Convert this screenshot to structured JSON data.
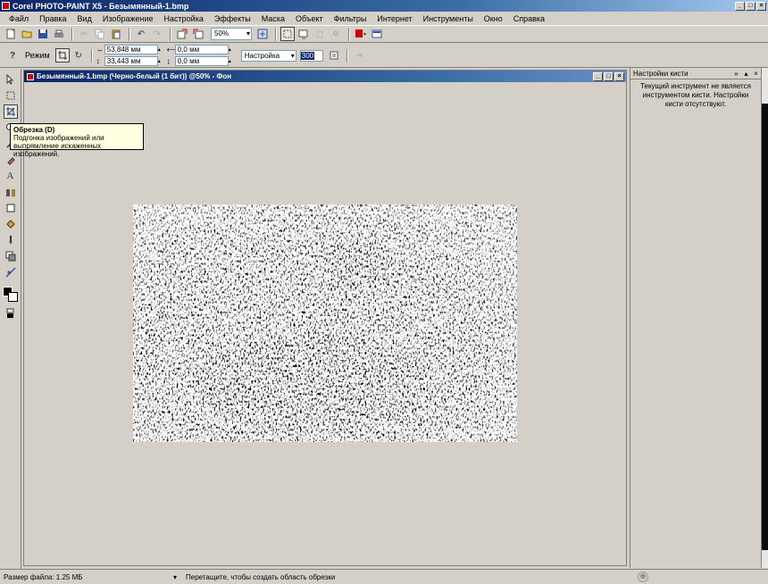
{
  "app": {
    "title": "Corel PHOTO-PAINT X5 - Безымянный-1.bmp",
    "window_controls": [
      "_",
      "□",
      "×"
    ]
  },
  "menu": [
    "Файл",
    "Правка",
    "Вид",
    "Изображение",
    "Настройка",
    "Эффекты",
    "Маска",
    "Объект",
    "Фильтры",
    "Интернет",
    "Инструменты",
    "Окно",
    "Справка"
  ],
  "toolbar": {
    "zoom_value": "50%"
  },
  "property_bar": {
    "mode_label": "Режим",
    "x_value": "53,848 мм",
    "y_value": "33,443 мм",
    "w_value": "0,0 мм",
    "h_value": "0,0 мм",
    "setting_combo": "Настройка",
    "resolution": "300"
  },
  "tooltip": {
    "title": "Обрезка (D)",
    "text": "Подгонка изображений или выпрямление искаженных изображений."
  },
  "document": {
    "title": "Безымянный-1.bmp (Черно-белый (1 бит)) @50% - Фон"
  },
  "docker": {
    "title": "Настройки кисти",
    "message": "Текущий инструмент не является инструментом кисти. Настройки кисти отсутствуют."
  },
  "status": {
    "file_size": "Размер файла: 1.25 МБ",
    "hint": "Перетащите, чтобы создать область обрезки"
  },
  "colors": {
    "title_gradient_start": "#0a246a",
    "title_gradient_end": "#a6caf0",
    "chrome": "#d4d0c8",
    "tooltip_bg": "#ffffe1"
  }
}
